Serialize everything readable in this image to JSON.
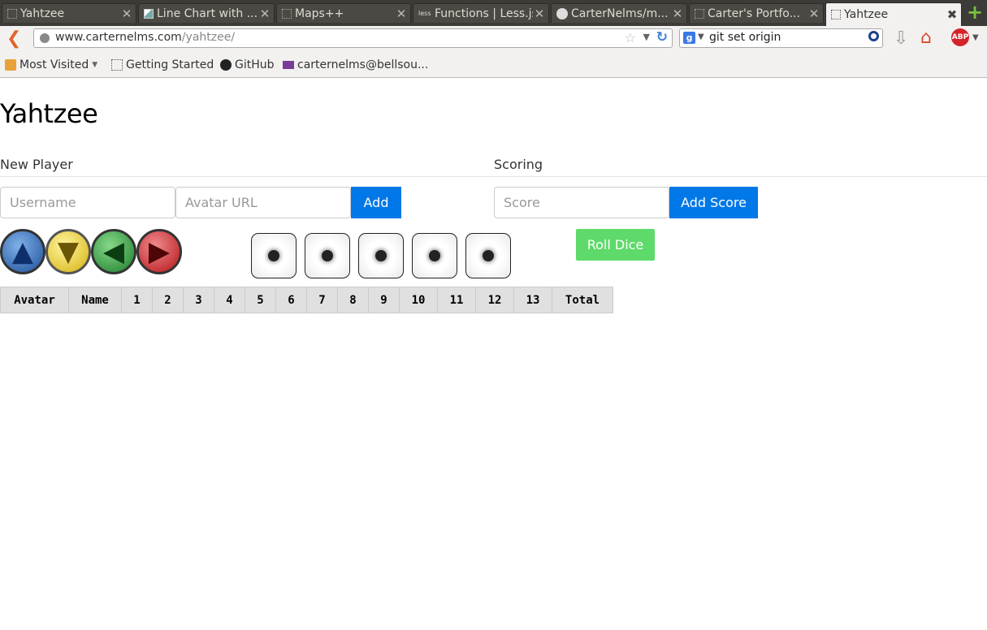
{
  "browser": {
    "tabs": [
      {
        "title": "Yahtzee",
        "icon": "blank-page-icon"
      },
      {
        "title": "Line Chart with ...",
        "icon": "chart-icon"
      },
      {
        "title": "Maps++",
        "icon": "blank-page-icon"
      },
      {
        "title": "Functions | Less.js",
        "icon": "less-icon"
      },
      {
        "title": "CarterNelms/m...",
        "icon": "github-icon"
      },
      {
        "title": "Carter's Portfo...",
        "icon": "blank-page-icon"
      },
      {
        "title": "Yahtzee",
        "icon": "blank-page-icon",
        "active": true
      }
    ],
    "url_domain": "www.carternelms.com",
    "url_path": "/yahtzee/",
    "search_value": "git set origin",
    "search_engine_letter": "g",
    "abp_label": "ABP",
    "bookmarks": [
      {
        "label": "Most Visited",
        "icon": "folder-icon"
      },
      {
        "label": "Getting Started",
        "icon": "blank-page-icon"
      },
      {
        "label": "GitHub",
        "icon": "github-icon"
      },
      {
        "label": "carternelms@bellsou...",
        "icon": "mail-icon"
      }
    ]
  },
  "page": {
    "title": "Yahtzee",
    "new_player": {
      "heading": "New Player",
      "username_placeholder": "Username",
      "avatar_placeholder": "Avatar URL",
      "add_label": "Add"
    },
    "scoring": {
      "heading": "Scoring",
      "score_placeholder": "Score",
      "add_score_label": "Add Score"
    },
    "roll_label": "Roll Dice",
    "avatars": [
      {
        "direction": "up",
        "color": "#3a78c9"
      },
      {
        "direction": "down",
        "color": "#e5c21f"
      },
      {
        "direction": "left",
        "color": "#2e9c3a"
      },
      {
        "direction": "right",
        "color": "#d8252a"
      }
    ],
    "dice": [
      1,
      1,
      1,
      1,
      1
    ],
    "table_headers": [
      "Avatar",
      "Name",
      "1",
      "2",
      "3",
      "4",
      "5",
      "6",
      "7",
      "8",
      "9",
      "10",
      "11",
      "12",
      "13",
      "Total"
    ]
  }
}
